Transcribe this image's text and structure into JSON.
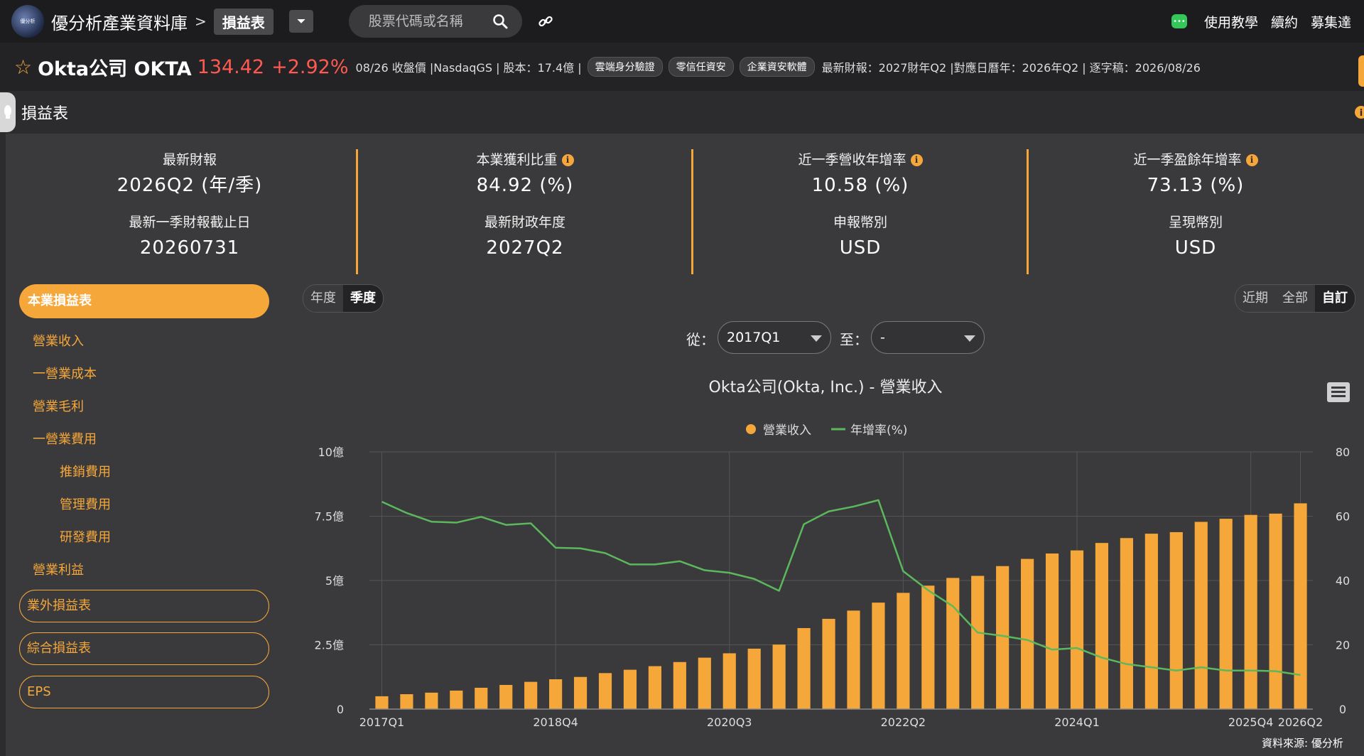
{
  "topbar": {
    "logo_text": "優分析",
    "brand": "優分析產業資料庫",
    "crumb_sep": ">",
    "crumb_current": "損益表",
    "search_placeholder": "股票代碼或名稱",
    "links": [
      "使用教學",
      "續約",
      "募集達"
    ]
  },
  "stock": {
    "name": "Okta公司 OKTA",
    "price": "134.42",
    "change": "+2.92%",
    "meta": "08/26 收盤價 |NasdaqGS | 股本：17.4億 |",
    "tags": [
      "雲端身分驗證",
      "零信任資安",
      "企業資安軟體"
    ],
    "meta2": "最新財報：2027財年Q2 |對應日曆年：2026年Q2 | 逐字稿：2026/08/26"
  },
  "section": {
    "title": "損益表"
  },
  "stats": [
    {
      "label1": "最新財報",
      "value1": "2026Q2 (年/季)",
      "label2": "最新一季財報截止日",
      "value2": "20260731",
      "info": false
    },
    {
      "label1": "本業獲利比重",
      "value1": "84.92 (%)",
      "label2": "最新財政年度",
      "value2": "2027Q2",
      "info": true
    },
    {
      "label1": "近一季營收年增率",
      "value1": "10.58 (%)",
      "label2": "申報幣別",
      "value2": "USD",
      "info": true
    },
    {
      "label1": "近一季盈餘年增率",
      "value1": "73.13 (%)",
      "label2": "呈現幣別",
      "value2": "USD",
      "info": true
    }
  ],
  "nav": {
    "active": "本業損益表",
    "items": [
      "營業收入",
      "一營業成本",
      "營業毛利",
      "一營業費用",
      "推銷費用",
      "管理費用",
      "研發費用",
      "營業利益"
    ],
    "buttons": [
      "業外損益表",
      "綜合損益表",
      "EPS"
    ]
  },
  "controls": {
    "period": [
      "年度",
      "季度"
    ],
    "period_active": "季度",
    "range": [
      "近期",
      "全部",
      "自訂"
    ],
    "range_active": "自訂",
    "from_label": "從：",
    "from_value": "2017Q1",
    "to_label": "至：",
    "to_value": "-"
  },
  "source": "資料來源: 優分析",
  "colors": {
    "accent": "#f5a73a",
    "line": "#5cb85c",
    "up": "#ff5a52"
  },
  "chart_data": {
    "type": "bar+line",
    "title": "Okta公司(Okta, Inc.) - 營業收入",
    "legend": [
      "營業收入",
      "年增率(%)"
    ],
    "legend_position": "top-center",
    "x_tick_labels": [
      "2017Q1",
      "2018Q4",
      "2020Q3",
      "2022Q2",
      "2024Q1",
      "2025Q4",
      "2026Q2"
    ],
    "y_left_ticks": [
      "0",
      "2.5億",
      "5億",
      "7.5億",
      "10億"
    ],
    "y_left_range": [
      0,
      10
    ],
    "y_left_unit": "億",
    "y_right_ticks": [
      "0",
      "20",
      "40",
      "60",
      "80"
    ],
    "y_right_range": [
      0,
      80
    ],
    "grid": true,
    "categories": [
      "2017Q1",
      "2017Q2",
      "2017Q3",
      "2017Q4",
      "2018Q1",
      "2018Q2",
      "2018Q3",
      "2018Q4",
      "2019Q1",
      "2019Q2",
      "2019Q3",
      "2019Q4",
      "2020Q1",
      "2020Q2",
      "2020Q3",
      "2020Q4",
      "2021Q1",
      "2021Q2",
      "2021Q3",
      "2021Q4",
      "2022Q1",
      "2022Q2",
      "2022Q3",
      "2022Q4",
      "2023Q1",
      "2023Q2",
      "2023Q3",
      "2023Q4",
      "2024Q1",
      "2024Q2",
      "2024Q3",
      "2024Q4",
      "2025Q1",
      "2025Q2",
      "2025Q3",
      "2025Q4",
      "2026Q1",
      "2026Q2"
    ],
    "series": [
      {
        "name": "營業收入",
        "kind": "bar",
        "axis": "left",
        "values": [
          0.5,
          0.58,
          0.64,
          0.72,
          0.83,
          0.94,
          1.06,
          1.16,
          1.25,
          1.4,
          1.53,
          1.67,
          1.83,
          2.0,
          2.17,
          2.35,
          2.51,
          3.15,
          3.51,
          3.83,
          4.14,
          4.52,
          4.8,
          5.1,
          5.18,
          5.56,
          5.84,
          6.05,
          6.17,
          6.46,
          6.65,
          6.82,
          6.88,
          7.28,
          7.4,
          7.55,
          7.6,
          8.0
        ]
      },
      {
        "name": "年增率(%)",
        "kind": "line",
        "axis": "right",
        "values": [
          64.5,
          61,
          58.3,
          58,
          59.8,
          57.3,
          57.8,
          50.2,
          50,
          48.5,
          45,
          45,
          46,
          43.2,
          42.4,
          40.5,
          36.8,
          57.5,
          61.5,
          63,
          65,
          42.9,
          37,
          32,
          23.8,
          22.8,
          21.5,
          18.5,
          19,
          16,
          14,
          13,
          12,
          13,
          12,
          12,
          11.8,
          10.6
        ]
      }
    ]
  }
}
